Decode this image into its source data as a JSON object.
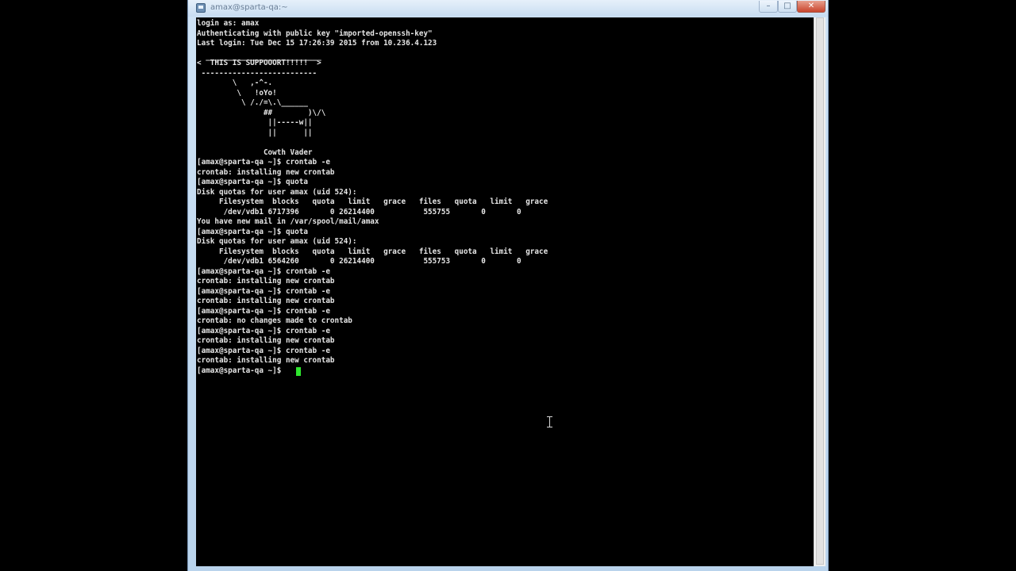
{
  "window": {
    "title": "amax@sparta-qa:~",
    "minimize_glyph": "–",
    "maximize_glyph": "□",
    "close_glyph": "✕"
  },
  "terminal": {
    "lines": [
      "login as: amax",
      "Authenticating with public key \"imported-openssh-key\"",
      "Last login: Tue Dec 15 17:26:39 2015 from 10.236.4.123",
      "  __________________________",
      "<  THIS IS SUPPOOORT!!!!!  >",
      " --------------------------",
      "        \\   ,-^-.",
      "         \\   !oYo!",
      "          \\ /./=\\.\\______",
      "               ##        )\\/\\",
      "                ||-----w||",
      "                ||      ||",
      "",
      "               Cowth Vader",
      "[amax@sparta-qa ~]$ crontab -e",
      "crontab: installing new crontab",
      "[amax@sparta-qa ~]$ quota",
      "Disk quotas for user amax (uid 524):",
      "     Filesystem  blocks   quota   limit   grace   files   quota   limit   grace",
      "      /dev/vdb1 6717396       0 26214400           555755       0       0",
      "You have new mail in /var/spool/mail/amax",
      "[amax@sparta-qa ~]$ quota",
      "Disk quotas for user amax (uid 524):",
      "     Filesystem  blocks   quota   limit   grace   files   quota   limit   grace",
      "      /dev/vdb1 6564260       0 26214400           555753       0       0",
      "[amax@sparta-qa ~]$ crontab -e",
      "crontab: installing new crontab",
      "[amax@sparta-qa ~]$ crontab -e",
      "crontab: installing new crontab",
      "[amax@sparta-qa ~]$ crontab -e",
      "crontab: no changes made to crontab",
      "[amax@sparta-qa ~]$ crontab -e",
      "crontab: installing new crontab",
      "[amax@sparta-qa ~]$ crontab -e",
      "crontab: installing new crontab",
      "[amax@sparta-qa ~]$ "
    ],
    "cursor_color": "#2ee62e",
    "text_color": "#e6e6e6",
    "background_color": "#000000"
  }
}
